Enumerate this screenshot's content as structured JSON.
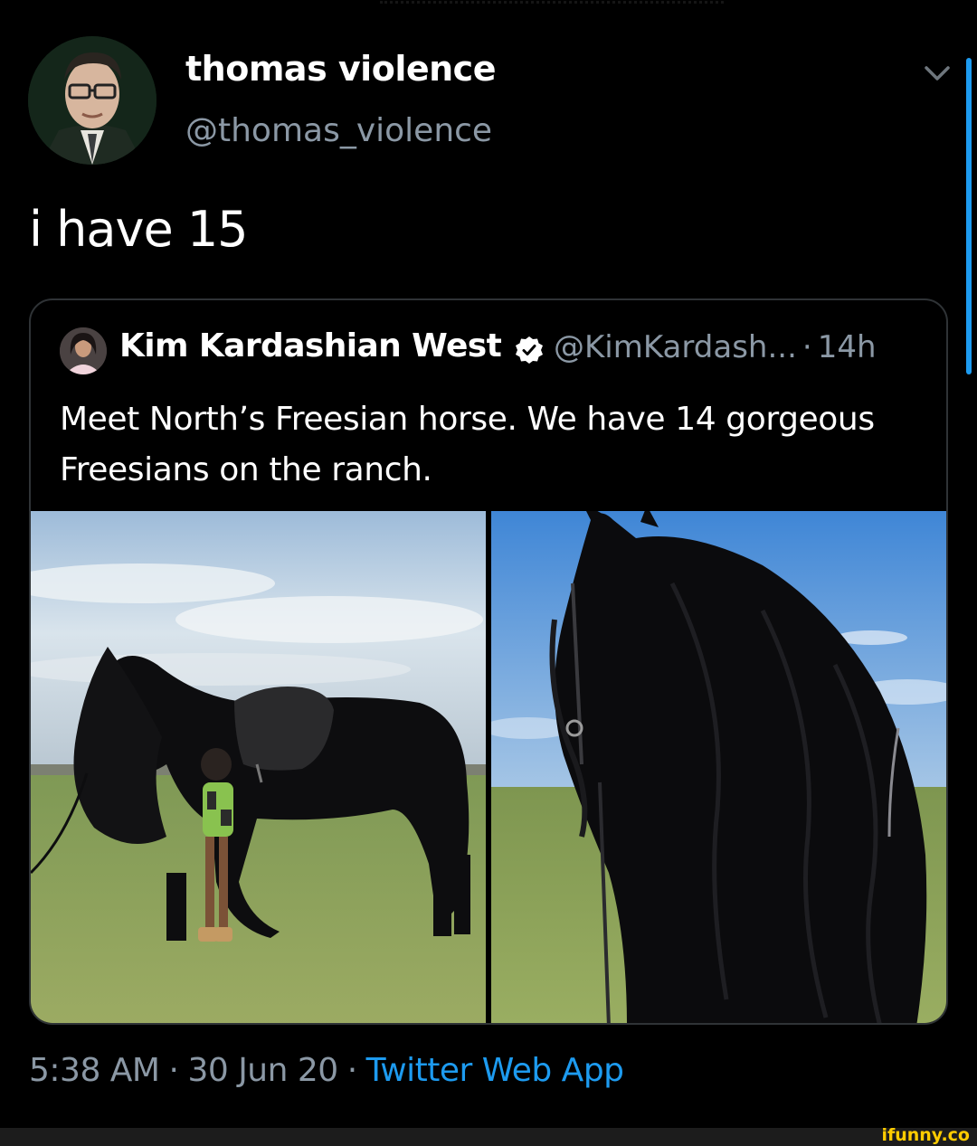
{
  "tweet": {
    "author": {
      "display_name": "thomas violence",
      "handle": "@thomas_violence"
    },
    "text": "i have 15",
    "timestamp": "5:38 AM",
    "date": "30 Jun 20",
    "source": "Twitter Web App",
    "separator": "·"
  },
  "quoted_tweet": {
    "author": {
      "display_name": "Kim Kardashian West",
      "handle": "@KimKardash...",
      "verified": true
    },
    "time_ago": "14h",
    "separator": "·",
    "text": "Meet North’s Freesian horse. We have 14 gorgeous Freesians on the ranch.",
    "media": [
      {
        "kind": "photo",
        "icon": "horse-with-child-photo"
      },
      {
        "kind": "photo",
        "icon": "horse-mane-closeup-photo"
      }
    ]
  },
  "watermark": {
    "text": "ifunny.co"
  },
  "colors": {
    "background": "#000000",
    "accent": "#1d9bf0",
    "muted": "#8b98a5",
    "border": "#2f3336",
    "watermark": "#ffcc00"
  },
  "icons": {
    "more": "chevron-down-icon",
    "verified": "verified-badge-icon"
  }
}
